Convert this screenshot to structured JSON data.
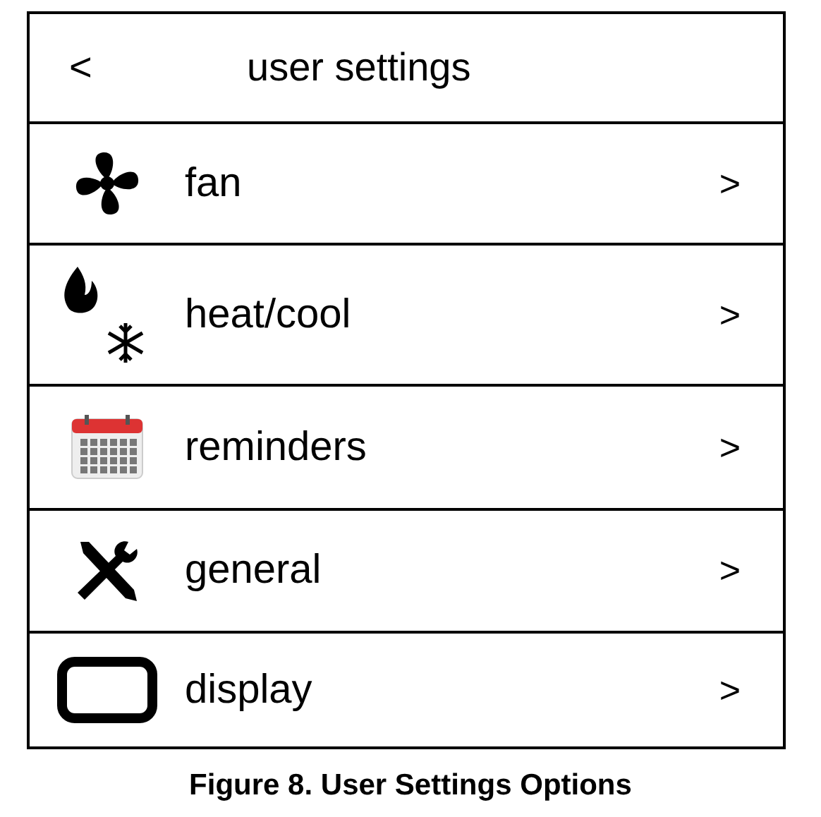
{
  "screen": {
    "back": "<",
    "title": "user settings",
    "items": [
      {
        "kind": "fan",
        "label": "fan",
        "arrow": ">"
      },
      {
        "kind": "heatcool",
        "label": "heat/cool",
        "arrow": ">"
      },
      {
        "kind": "calendar",
        "label": "reminders",
        "arrow": ">"
      },
      {
        "kind": "tools",
        "label": "general",
        "arrow": ">"
      },
      {
        "kind": "display",
        "label": "display",
        "arrow": ">"
      }
    ]
  },
  "caption": "Figure 8. User Settings Options"
}
